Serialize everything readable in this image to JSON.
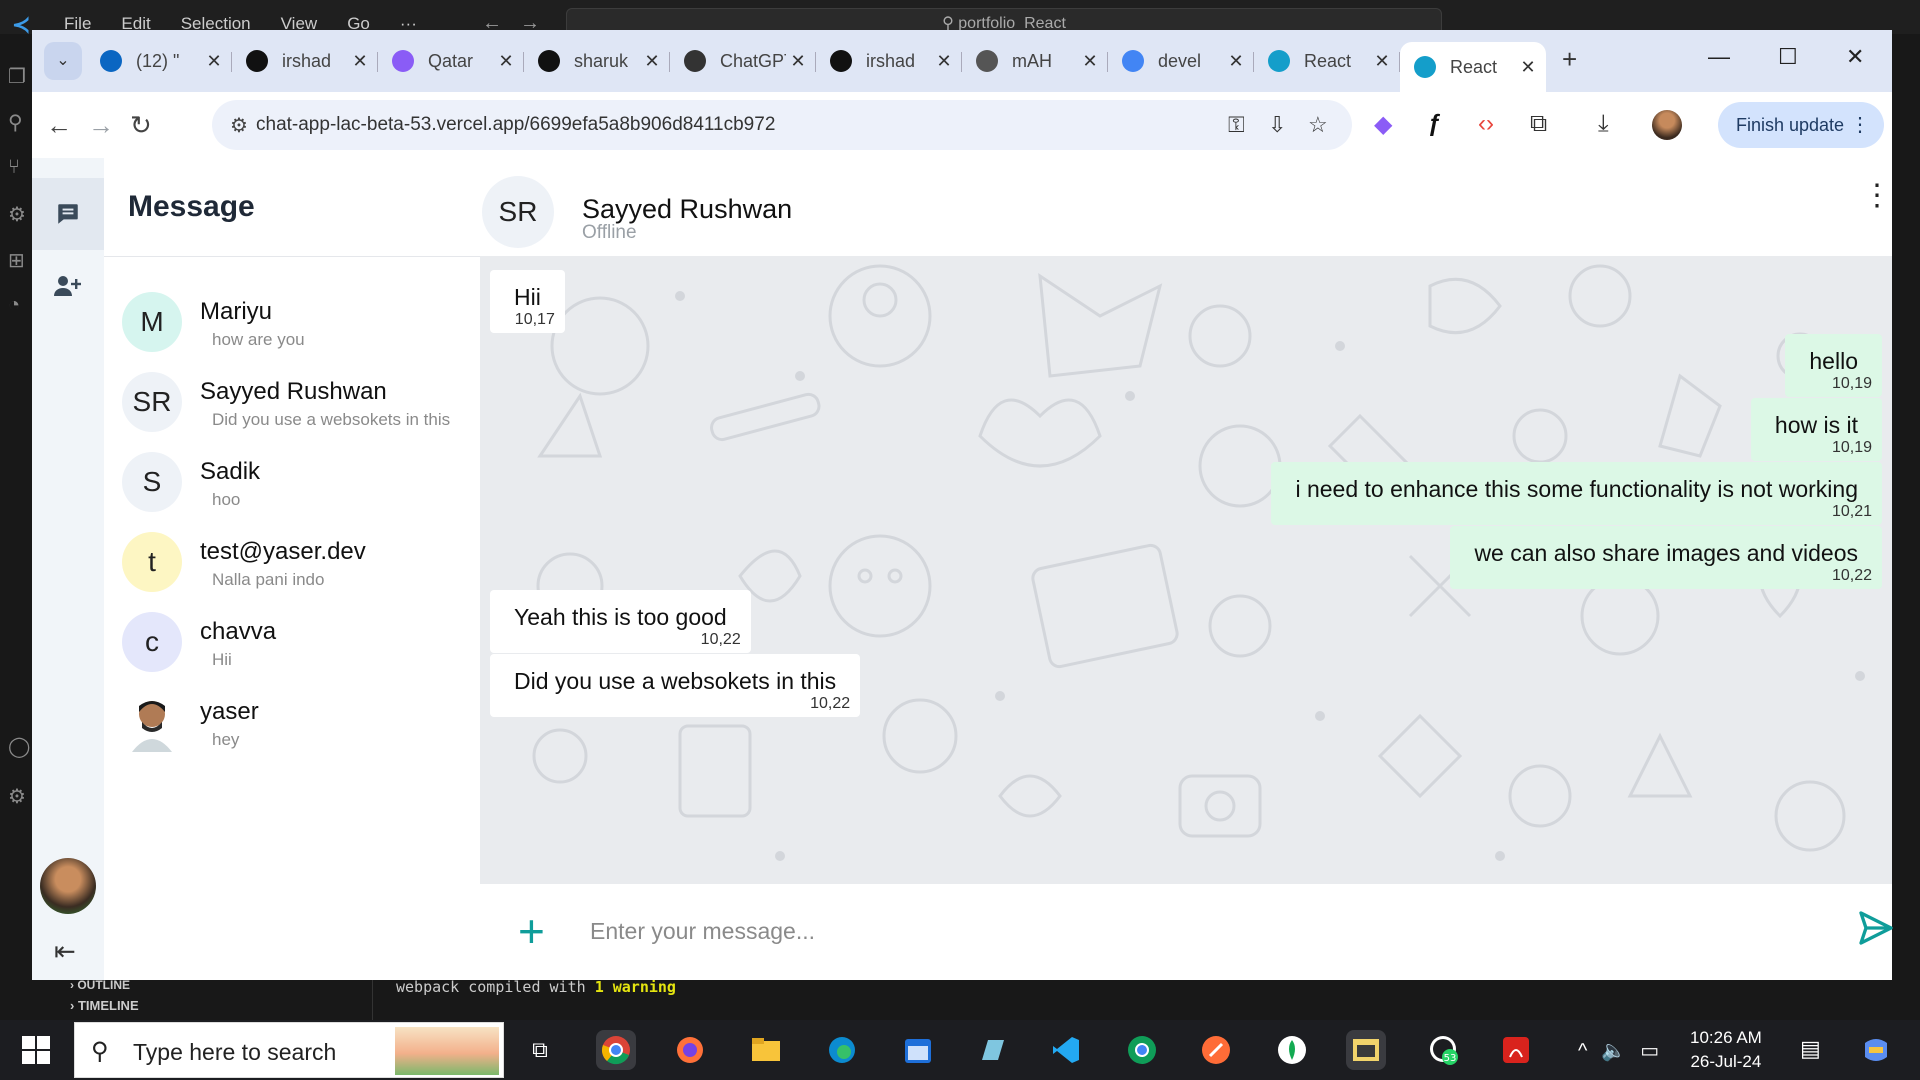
{
  "vscode": {
    "menu": [
      "File",
      "Edit",
      "Selection",
      "View",
      "Go",
      "···"
    ],
    "command_center": "portfolio_React",
    "outline_label": "OUTLINE",
    "timeline_label": "TIMELINE",
    "terminal_text": "webpack compiled with ",
    "terminal_warning": "1 warning"
  },
  "browser": {
    "tabs": [
      {
        "label": "(12) \"",
        "icon": "linkedin-icon",
        "color": "#0a66c2"
      },
      {
        "label": "irshad",
        "icon": "github-icon",
        "color": "#111111"
      },
      {
        "label": "Qatar",
        "icon": "vite-icon",
        "color": "#8a5cf6"
      },
      {
        "label": "sharuk",
        "icon": "github-icon",
        "color": "#111111"
      },
      {
        "label": "ChatGPT",
        "icon": "openai-icon",
        "color": "#333333"
      },
      {
        "label": "irshad",
        "icon": "github-icon",
        "color": "#111111"
      },
      {
        "label": "mAH",
        "icon": "globe-icon",
        "color": "#555555"
      },
      {
        "label": "devel",
        "icon": "google-icon",
        "color": "#4285f4"
      },
      {
        "label": "React",
        "icon": "react-icon",
        "color": "#149eca"
      },
      {
        "label": "React",
        "icon": "react-icon",
        "color": "#149eca"
      }
    ],
    "active_tab_index": 9,
    "url": "chat-app-lac-beta-53.vercel.app/6699efa5a8b906d8411cb972",
    "finish_update_label": "Finish update"
  },
  "app": {
    "sidebar_title": "Message",
    "conversations": [
      {
        "initials": "M",
        "name": "Mariyu",
        "preview": "how are you",
        "avatar_color": "#d6f5ef"
      },
      {
        "initials": "SR",
        "name": "Sayyed Rushwan",
        "preview": "Did you use a websokets in this",
        "avatar_color": "#eef2f7"
      },
      {
        "initials": "S",
        "name": "Sadik",
        "preview": "hoo",
        "avatar_color": "#eef2f7"
      },
      {
        "initials": "t",
        "name": "test@yaser.dev",
        "preview": "Nalla pani indo",
        "avatar_color": "#fdf6c3"
      },
      {
        "initials": "c",
        "name": "chavva",
        "preview": "Hii",
        "avatar_color": "#e4e7fb"
      },
      {
        "initials": "",
        "name": "yaser",
        "preview": "hey",
        "avatar_color": "#ffffff"
      }
    ],
    "chat": {
      "initials": "SR",
      "name": "Sayyed Rushwan",
      "status": "Offline",
      "messages": [
        {
          "dir": "in",
          "text": "Hii",
          "time": "10,17"
        },
        {
          "dir": "out",
          "text": "hello",
          "time": "10,19"
        },
        {
          "dir": "out",
          "text": "how is it",
          "time": "10,19"
        },
        {
          "dir": "out",
          "text": "i need to enhance this some functionality is not working",
          "time": "10,21"
        },
        {
          "dir": "out",
          "text": "we can also share images and videos",
          "time": "10,22"
        },
        {
          "dir": "in",
          "text": "Yeah this is too good",
          "time": "10,22"
        },
        {
          "dir": "in",
          "text": "Did you use a websokets in this",
          "time": "10,22"
        }
      ],
      "input_placeholder": "Enter your message...",
      "accent": "#0f9d9a"
    }
  },
  "taskbar": {
    "search_placeholder": "Type here to search",
    "time": "10:26 AM",
    "date": "26-Jul-24",
    "whatsapp_badge": "53"
  }
}
